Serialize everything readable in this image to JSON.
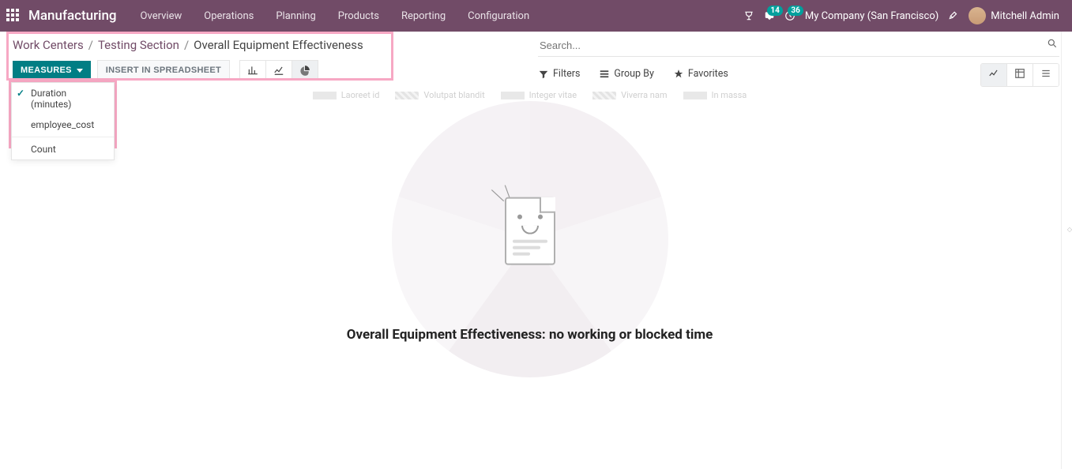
{
  "nav": {
    "app_title": "Manufacturing",
    "items": [
      "Overview",
      "Operations",
      "Planning",
      "Products",
      "Reporting",
      "Configuration"
    ],
    "messages_badge": "14",
    "activities_badge": "36",
    "company": "My Company (San Francisco)",
    "user": "Mitchell Admin"
  },
  "breadcrumb": {
    "a": "Work Centers",
    "b": "Testing Section",
    "c": "Overall Equipment Effectiveness"
  },
  "toolbar": {
    "measures_label": "MEASURES",
    "insert_label": "INSERT IN SPREADSHEET"
  },
  "measures_menu": {
    "item1": "Duration (minutes)",
    "item2": "employee_cost",
    "item3": "Count"
  },
  "search": {
    "placeholder": "Search...",
    "filters": "Filters",
    "groupby": "Group By",
    "favorites": "Favorites"
  },
  "legend": {
    "a": "Laoreet id",
    "b": "Volutpat blandit",
    "c": "Integer vitae",
    "d": "Viverra nam",
    "e": "In massa"
  },
  "empty": {
    "message": "Overall Equipment Effectiveness: no working or blocked time"
  }
}
